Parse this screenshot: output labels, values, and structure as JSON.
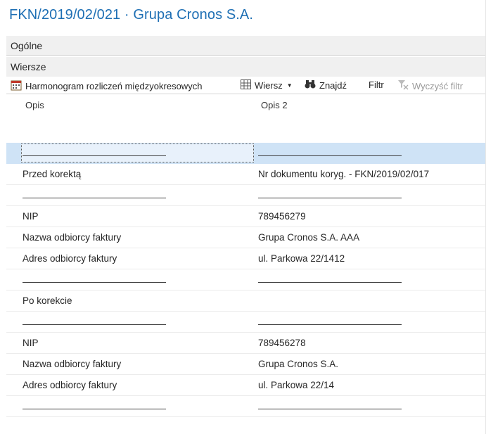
{
  "title": "FKN/2019/02/021 · Grupa Cronos S.A.",
  "sections": {
    "general": "Ogólne",
    "lines": "Wiersze"
  },
  "toolbar": {
    "schedule": "Harmonogram rozliczeń międzyokresowych",
    "line": "Wiersz",
    "find": "Znajdź",
    "filter": "Filtr",
    "clear_filter": "Wyczyść filtr"
  },
  "columns": {
    "col1": "Opis",
    "col2": "Opis 2"
  },
  "rows": [
    {
      "opis": "",
      "opis2": ""
    },
    {
      "opis": "Przed korektą",
      "opis2": "Nr dokumentu koryg. - FKN/2019/02/017"
    },
    {
      "opis": "",
      "opis2": ""
    },
    {
      "opis": "NIP",
      "opis2": "789456279"
    },
    {
      "opis": "Nazwa odbiorcy faktury",
      "opis2": "Grupa Cronos S.A. AAA"
    },
    {
      "opis": "Adres odbiorcy faktury",
      "opis2": "ul. Parkowa 22/1412"
    },
    {
      "opis": "",
      "opis2": ""
    },
    {
      "opis": "Po korekcie",
      "opis2": ""
    },
    {
      "opis": "",
      "opis2": ""
    },
    {
      "opis": "NIP",
      "opis2": "789456278"
    },
    {
      "opis": "Nazwa odbiorcy faktury",
      "opis2": "Grupa Cronos S.A."
    },
    {
      "opis": "Adres odbiorcy faktury",
      "opis2": "ul. Parkowa 22/14"
    },
    {
      "opis": "",
      "opis2": ""
    }
  ],
  "colors": {
    "accent": "#1e6fb4",
    "selected_row": "#cfe3f6"
  }
}
